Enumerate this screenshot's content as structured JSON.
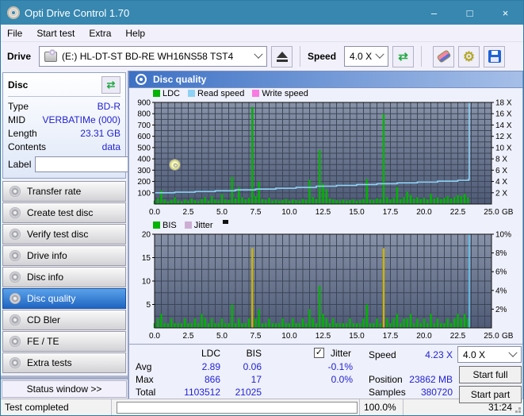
{
  "window": {
    "title": "Opti Drive Control 1.70",
    "minimize": "–",
    "maximize": "□",
    "close": "×"
  },
  "menu": {
    "items": [
      "File",
      "Start test",
      "Extra",
      "Help"
    ]
  },
  "toolbar": {
    "drive_label": "Drive",
    "drive_value": "(E:)  HL-DT-ST BD-RE  WH16NS58 TST4",
    "speed_label": "Speed",
    "speed_value": "4.0 X"
  },
  "disc_panel": {
    "title": "Disc",
    "rows": [
      {
        "label": "Type",
        "value": "BD-R"
      },
      {
        "label": "MID",
        "value": "VERBATIMe (000)"
      },
      {
        "label": "Length",
        "value": "23.31 GB"
      },
      {
        "label": "Contents",
        "value": "data"
      }
    ],
    "label_field": {
      "label": "Label",
      "value": ""
    }
  },
  "sidebar": {
    "buttons": [
      {
        "label": "Transfer rate"
      },
      {
        "label": "Create test disc"
      },
      {
        "label": "Verify test disc"
      },
      {
        "label": "Drive info"
      },
      {
        "label": "Disc info"
      },
      {
        "label": "Disc quality"
      },
      {
        "label": "CD Bler"
      },
      {
        "label": "FE / TE"
      },
      {
        "label": "Extra tests"
      }
    ],
    "selected_index": 5,
    "status_window_label": "Status window >>"
  },
  "content_header": "Disc quality",
  "stats": {
    "col_ldc": "LDC",
    "col_bis": "BIS",
    "col_jitter": "Jitter",
    "rows": [
      {
        "label": "Avg",
        "ldc": "2.89",
        "bis": "0.06",
        "jitter": "-0.1%"
      },
      {
        "label": "Max",
        "ldc": "866",
        "bis": "17",
        "jitter": "0.0%"
      },
      {
        "label": "Total",
        "ldc": "1103512",
        "bis": "21025",
        "jitter": ""
      }
    ],
    "jitter_checked": "✓",
    "speed_label": "Speed",
    "speed_value": "4.23 X",
    "position_label": "Position",
    "position_value": "23862 MB",
    "samples_label": "Samples",
    "samples_value": "380720",
    "speed_select": "4.0 X",
    "start_full": "Start full",
    "start_part": "Start part"
  },
  "statusbar": {
    "status": "Test completed",
    "percent": "100.0%",
    "time": "31:24"
  },
  "colors": {
    "titlebar": "#3787b0",
    "accent_blue": "#1f1fcf",
    "ldc_green": "#00b400",
    "read_speed_cyan": "#8ed2f5",
    "write_speed_pink": "#f87ae2",
    "jitter_lilac": "#cdaed3",
    "spike_yellow": "#ccb400",
    "plot_top": "#8792a8",
    "plot_bottom": "#4f5b76",
    "grid": "#3c4659"
  },
  "chart_data": [
    {
      "type": "bar",
      "name": "ldc-read-write-chart",
      "legend": [
        {
          "label": "LDC",
          "color": "#00b400"
        },
        {
          "label": "Read speed",
          "color": "#8ed2f5"
        },
        {
          "label": "Write speed",
          "color": "#f87ae2"
        }
      ],
      "x_max": 25,
      "x_grid": 0.5,
      "x_unit": "GB",
      "x_ticks": [
        0.0,
        2.5,
        5.0,
        7.5,
        10.0,
        12.5,
        15.0,
        17.5,
        20.0,
        22.5,
        25.0
      ],
      "y_max": 900,
      "y_grid": 50,
      "left_ticks": [
        900,
        800,
        700,
        600,
        500,
        400,
        300,
        200,
        100
      ],
      "right_ticks": [
        {
          "v": 900,
          "label": "18 X"
        },
        {
          "v": 800,
          "label": "16 X"
        },
        {
          "v": 700,
          "label": "14 X"
        },
        {
          "v": 600,
          "label": "12 X"
        },
        {
          "v": 500,
          "label": "10 X"
        },
        {
          "v": 400,
          "label": "8 X"
        },
        {
          "v": 300,
          "label": "6 X"
        },
        {
          "v": 200,
          "label": "4 X"
        },
        {
          "v": 100,
          "label": "2 X"
        }
      ],
      "bars": {
        "series": "LDC",
        "x_step": 0.25,
        "color": "#00b400",
        "highlight_threshold": 9999,
        "highlight_color": "#ccb400",
        "values": [
          30,
          55,
          120,
          40,
          25,
          35,
          60,
          30,
          25,
          40,
          30,
          50,
          35,
          25,
          45,
          60,
          30,
          70,
          40,
          30,
          90,
          40,
          35,
          240,
          50,
          150,
          60,
          40,
          55,
          860,
          70,
          200,
          45,
          35,
          55,
          30,
          40,
          30,
          35,
          45,
          30,
          40,
          35,
          30,
          45,
          35,
          215,
          60,
          45,
          480,
          180,
          130,
          50,
          40,
          35,
          30,
          40,
          30,
          35,
          40,
          30,
          35,
          45,
          220,
          40,
          35,
          50,
          45,
          800,
          60,
          40,
          55,
          150,
          45,
          60,
          110,
          80,
          50,
          60,
          45,
          55,
          40,
          90,
          50,
          60,
          45,
          55,
          70,
          50,
          60,
          80,
          70,
          90,
          60
        ]
      },
      "line": {
        "series": "Read speed",
        "color": "#8ed2f5",
        "mode": "staircase",
        "scale": 50,
        "points": [
          [
            0,
            2.0
          ],
          [
            1.5,
            2.1
          ],
          [
            3,
            2.2
          ],
          [
            4.5,
            2.35
          ],
          [
            6,
            2.5
          ],
          [
            7.5,
            2.65
          ],
          [
            9,
            2.8
          ],
          [
            10.5,
            2.95
          ],
          [
            12,
            3.15
          ],
          [
            13.5,
            3.3
          ],
          [
            15,
            3.45
          ],
          [
            16.5,
            3.6
          ],
          [
            18,
            3.75
          ],
          [
            19.5,
            3.9
          ],
          [
            21,
            4.05
          ],
          [
            22.5,
            4.2
          ],
          [
            23.3,
            4.35
          ],
          [
            23.35,
            18
          ]
        ]
      },
      "vline": null
    },
    {
      "type": "bar",
      "name": "bis-jitter-chart",
      "legend": [
        {
          "label": "BIS",
          "color": "#00b400"
        },
        {
          "label": "Jitter",
          "color": "#cdaed3"
        }
      ],
      "x_max": 25,
      "x_grid": 0.5,
      "x_unit": "GB",
      "x_ticks": [
        0.0,
        2.5,
        5.0,
        7.5,
        10.0,
        12.5,
        15.0,
        17.5,
        20.0,
        22.5,
        25.0
      ],
      "y_max": 20,
      "y_grid": 2.5,
      "left_ticks": [
        20,
        15,
        10,
        5
      ],
      "right_ticks": [
        {
          "v": 20,
          "label": "10%"
        },
        {
          "v": 16,
          "label": "8%"
        },
        {
          "v": 12,
          "label": "6%"
        },
        {
          "v": 8,
          "label": "4%"
        },
        {
          "v": 4,
          "label": "2%"
        }
      ],
      "bars": {
        "series": "BIS",
        "x_step": 0.25,
        "color": "#00b400",
        "highlight_threshold": 10,
        "highlight_color": "#ccb400",
        "values": [
          1,
          2,
          3,
          1,
          1,
          2,
          1,
          1,
          1,
          2,
          1,
          1,
          2,
          1,
          3,
          2,
          1,
          2,
          1,
          1,
          2,
          1,
          1,
          5,
          1,
          2,
          1,
          1,
          2,
          17,
          2,
          4,
          1,
          1,
          2,
          1,
          1,
          1,
          2,
          1,
          1,
          2,
          1,
          1,
          2,
          1,
          4,
          2,
          1,
          9,
          3,
          2,
          1,
          2,
          1,
          1,
          1,
          1,
          2,
          1,
          1,
          1,
          2,
          5,
          1,
          1,
          2,
          1,
          17,
          2,
          1,
          2,
          3,
          1,
          2,
          2,
          3,
          1,
          2,
          1,
          2,
          1,
          3,
          1,
          2,
          1,
          1,
          2,
          1,
          2,
          3,
          2,
          3,
          2
        ]
      },
      "line": null,
      "vline": {
        "x": 23.35,
        "color": "#63c8f5"
      }
    }
  ]
}
